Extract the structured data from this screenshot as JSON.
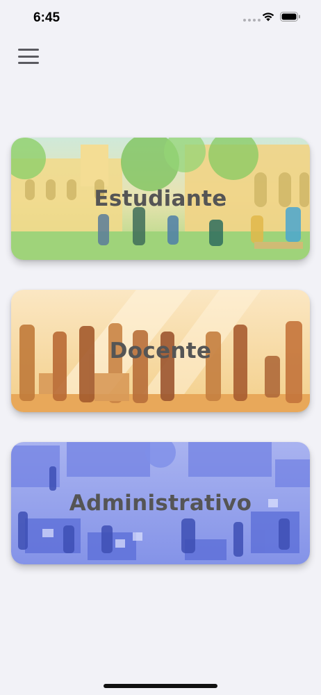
{
  "status_bar": {
    "time": "6:45",
    "icons": [
      "signal-dots-icon",
      "wifi-icon",
      "battery-icon"
    ]
  },
  "header": {
    "menu_icon": "hamburger-menu-icon"
  },
  "cards": [
    {
      "id": "estudiante",
      "label": "Estudiante",
      "theme_color": "#9fd37a",
      "accent": "#f2d98a"
    },
    {
      "id": "docente",
      "label": "Docente",
      "theme_color": "#f3c77a",
      "accent": "#e8a85a"
    },
    {
      "id": "administrativo",
      "label": "Administrativo",
      "theme_color": "#8e9ff0",
      "accent": "#6f7fe3"
    }
  ],
  "colors": {
    "background": "#f2f2f7",
    "label_text": "#555555"
  }
}
